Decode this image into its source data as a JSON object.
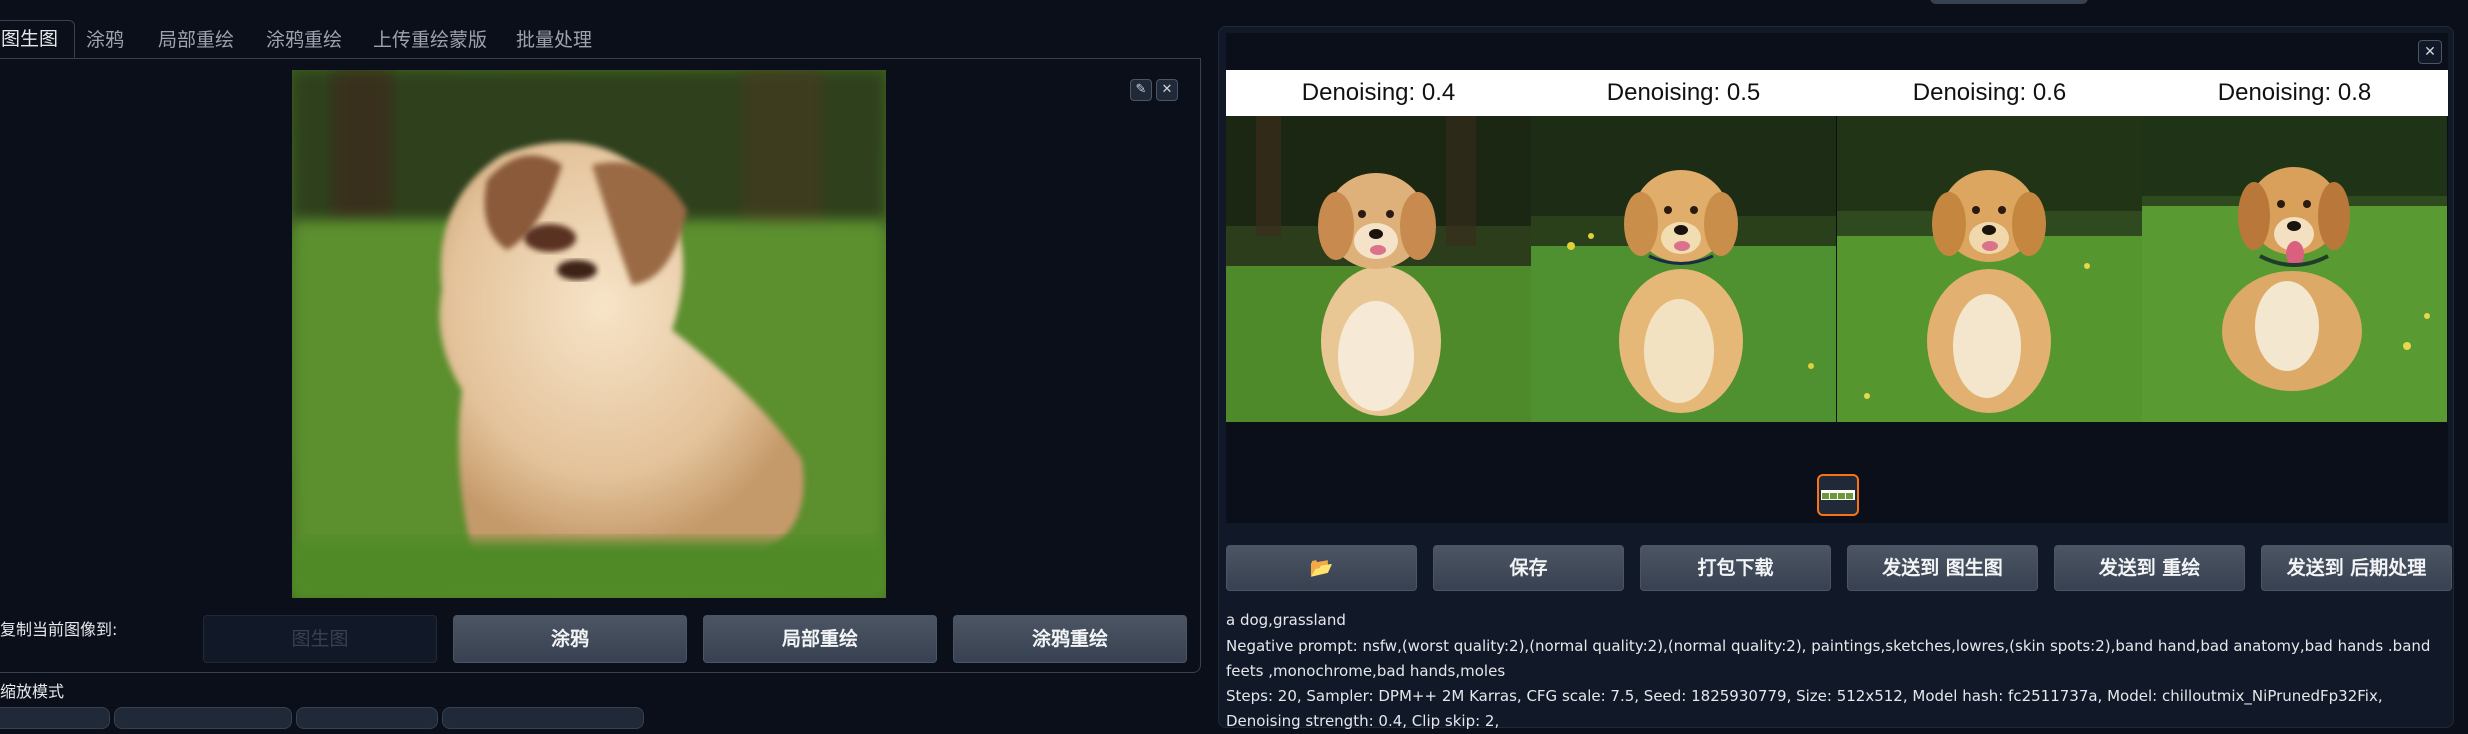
{
  "tabs": [
    "图生图",
    "涂鸦",
    "局部重绘",
    "涂鸦重绘",
    "上传重绘蒙版",
    "批量处理"
  ],
  "source_icons": [
    "pencil-icon",
    "close-icon"
  ],
  "copy_section": {
    "label": "复制当前图像到:",
    "buttons": [
      "图生图",
      "涂鸦",
      "局部重绘",
      "涂鸦重绘"
    ]
  },
  "mode_label": "缩放模式",
  "gallery": {
    "columns": [
      "Denoising: 0.4",
      "Denoising: 0.5",
      "Denoising: 0.6",
      "Denoising: 0.8"
    ],
    "close_icon": "close-icon"
  },
  "actions": {
    "folder_icon": "📂",
    "labels": [
      "保存",
      "打包下载",
      "发送到 图生图",
      "发送到 重绘",
      "发送到 后期处理"
    ]
  },
  "generation_info": {
    "prompt": "a dog,grassland",
    "negative": "Negative prompt: nsfw,(worst quality:2),(normal quality:2),(normal quality:2), paintings,sketches,lowres,(skin spots:2),band hand,bad anatomy,bad hands .band feets ,monochrome,bad hands,moles",
    "params": "Steps: 20, Sampler: DPM++ 2M Karras, CFG scale: 7.5, Seed: 1825930779, Size: 512x512, Model hash: fc2511737a, Model: chilloutmix_NiPrunedFp32Fix, Denoising strength: 0.4, Clip skip: 2,"
  },
  "colors": {
    "accent": "#f97316",
    "background": "#0b0f19",
    "panel": "#111827"
  }
}
